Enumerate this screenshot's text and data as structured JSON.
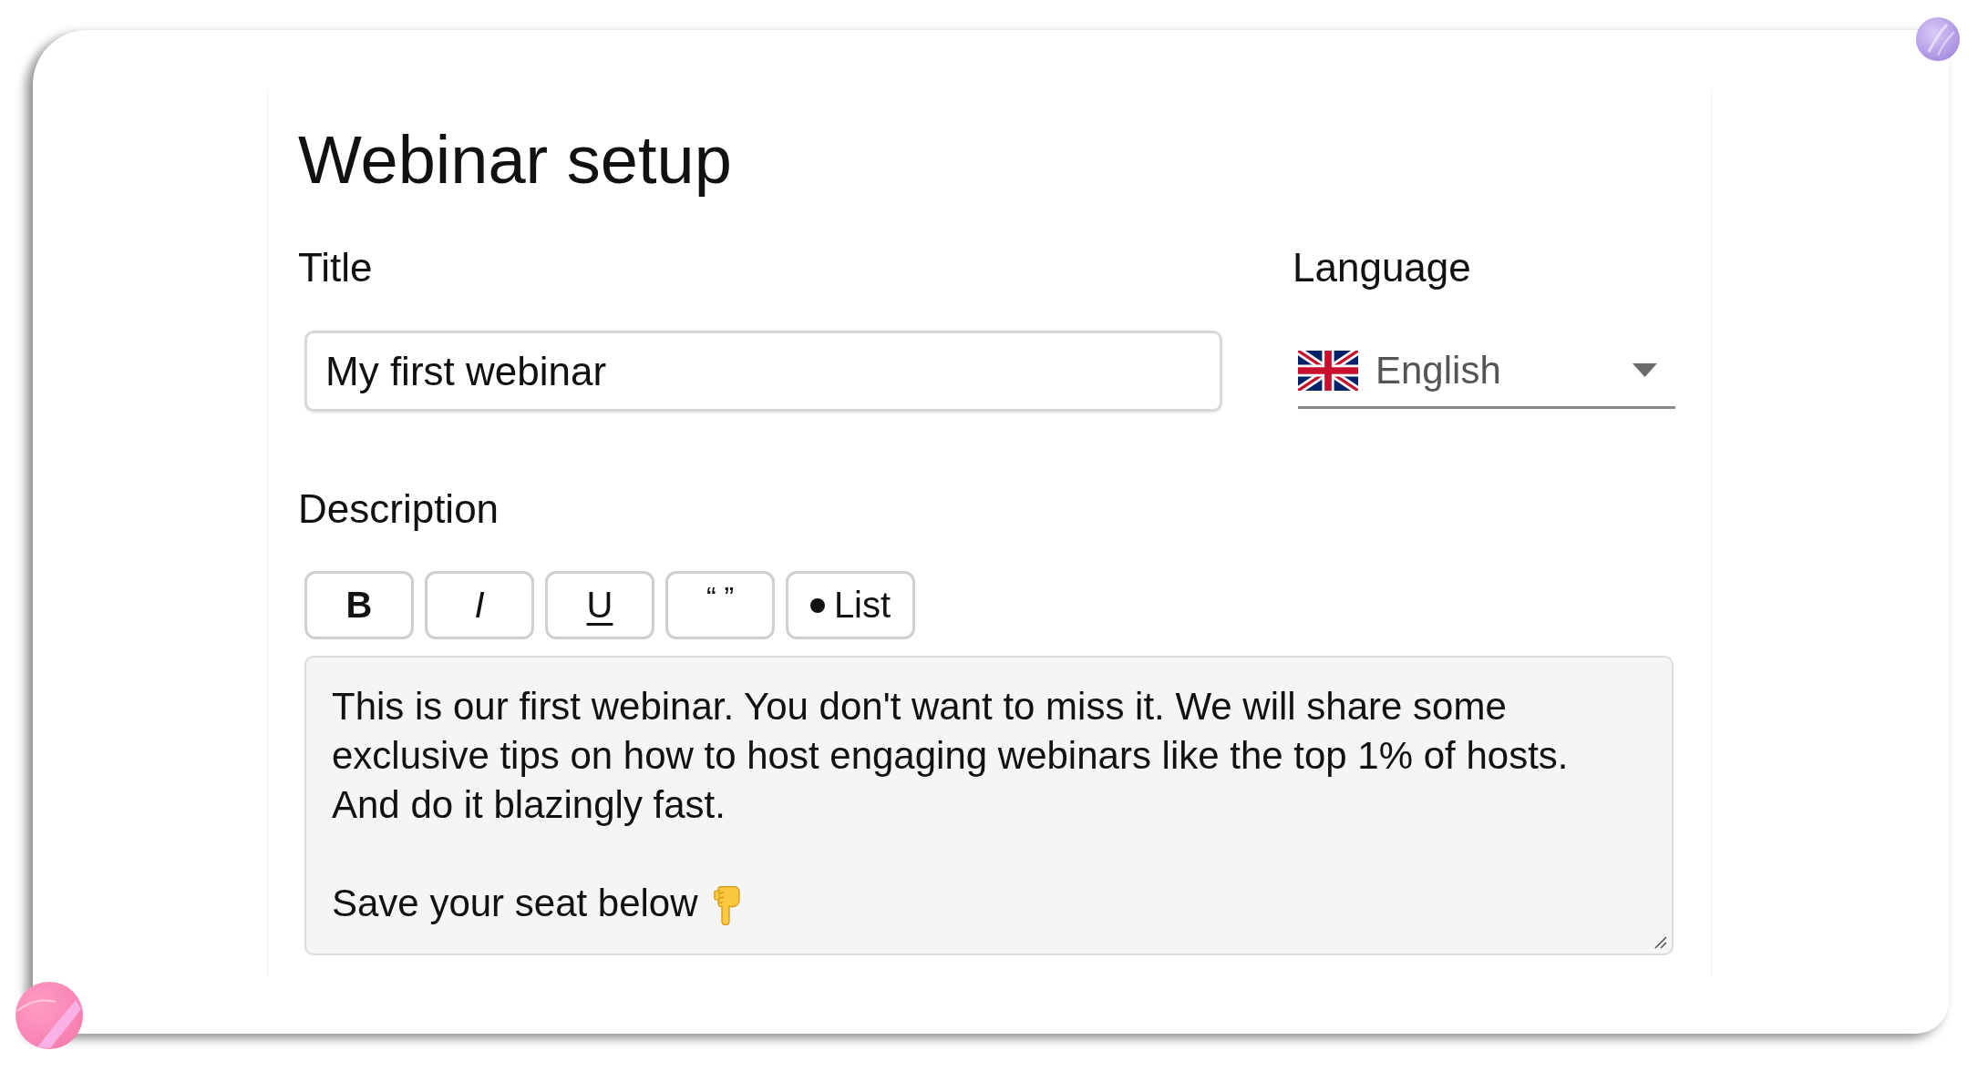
{
  "page_title": "Webinar setup",
  "title_field": {
    "label": "Title",
    "value": "My first webinar"
  },
  "language_field": {
    "label": "Language",
    "value": "English"
  },
  "description": {
    "label": "Description",
    "toolbar": [
      {
        "kind": "bold",
        "label": "B"
      },
      {
        "kind": "italic",
        "label": "I"
      },
      {
        "kind": "underline",
        "label": "U"
      },
      {
        "kind": "quote",
        "label": "“ ”"
      },
      {
        "kind": "list",
        "label": "List"
      }
    ],
    "paragraphs": [
      {
        "text": "This is our first webinar. You don't want to miss it. We will share some exclusive tips on how to host engaging webinars like the top 1% of hosts. And do it blazingly fast.",
        "emoji": false
      },
      {
        "text": "Save your seat below",
        "emoji": true
      }
    ]
  }
}
